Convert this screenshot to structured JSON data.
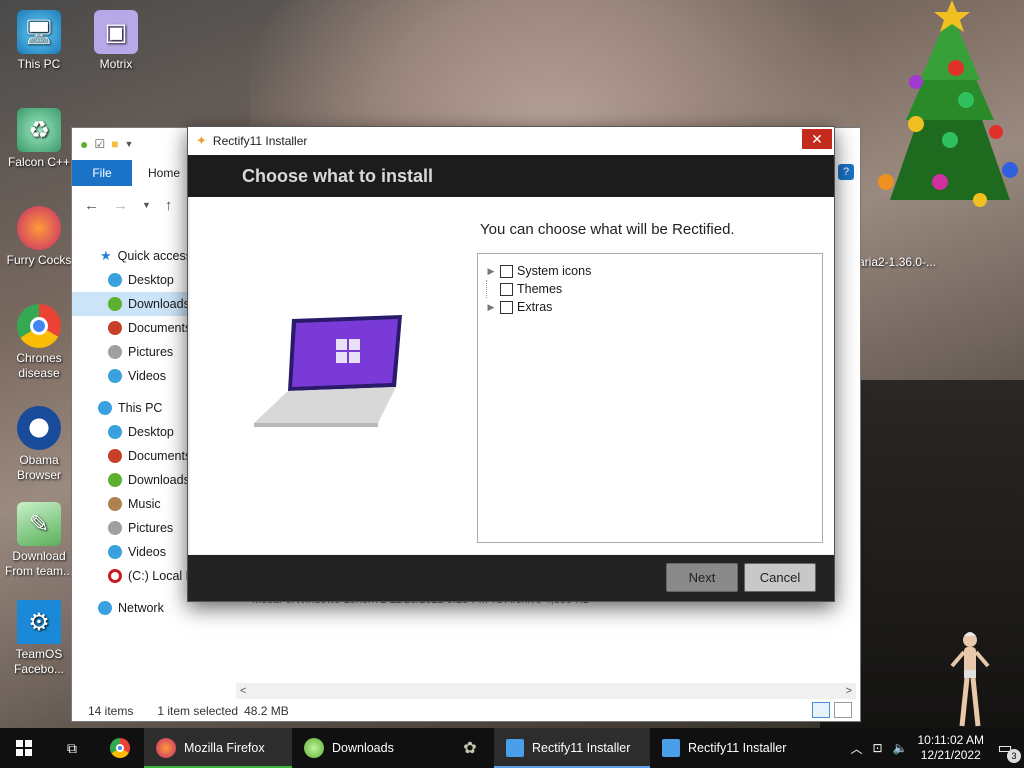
{
  "desktop": {
    "icons": [
      {
        "label": "This PC",
        "icon": "computer-icon"
      },
      {
        "label": "Motrix",
        "icon": "motrix-icon"
      },
      {
        "label": "Falcon C++",
        "icon": "falcon-icon"
      },
      {
        "label": "Furry Cocks",
        "icon": "firefox-icon"
      },
      {
        "label": "Chrones disease",
        "icon": "chrome-icon"
      },
      {
        "label": "Obama Browser",
        "icon": "obama-logo-icon"
      },
      {
        "label": "Download From team...",
        "icon": "notepad-icon"
      },
      {
        "label": "TeamOS Facebo...",
        "icon": "gear-icon"
      }
    ],
    "aria_label": "aria2-1.36.0-..."
  },
  "explorer": {
    "ribbon": {
      "file": "File",
      "home": "Home"
    },
    "tree": [
      {
        "label": "Quick access",
        "color": "#2a7fd4",
        "indent": 0
      },
      {
        "label": "Desktop",
        "color": "#3aa0e0",
        "indent": 1
      },
      {
        "label": "Downloads",
        "color": "#5cb030",
        "indent": 1,
        "selected": true
      },
      {
        "label": "Documents",
        "color": "#c8402c",
        "indent": 1
      },
      {
        "label": "Pictures",
        "color": "#a0a0a0",
        "indent": 1
      },
      {
        "label": "Videos",
        "color": "#3aa0e0",
        "indent": 1
      },
      {
        "label": "This PC",
        "color": "#3aa0e0",
        "indent": 0
      },
      {
        "label": "Desktop",
        "color": "#3aa0e0",
        "indent": 1
      },
      {
        "label": "Documents",
        "color": "#c8402c",
        "indent": 1
      },
      {
        "label": "Downloads",
        "color": "#5cb030",
        "indent": 1
      },
      {
        "label": "Music",
        "color": "#b08050",
        "indent": 1
      },
      {
        "label": "Pictures",
        "color": "#a0a0a0",
        "indent": 1
      },
      {
        "label": "Videos",
        "color": "#3aa0e0",
        "indent": 1
      },
      {
        "label": "(C:) Local D",
        "color": "#c81c1c",
        "indent": 1
      },
      {
        "label": "Network",
        "color": "#3aa0e0",
        "indent": 0
      }
    ],
    "partial_file_row": "MesaForWindows-Lorion72    11/25/2022 5:28 PM    7z Archive    4,859 KB",
    "right_col": [
      "B",
      "B",
      "B",
      "B",
      "B",
      "B",
      "B",
      "B",
      "B",
      "B",
      "B",
      "B",
      "B",
      "B",
      "B",
      "B"
    ],
    "status": {
      "items": "14 items",
      "selected": "1 item selected",
      "size": "48.2 MB"
    }
  },
  "installer": {
    "title": "Rectify11 Installer",
    "heading": "Choose what to install",
    "subtitle": "You can choose what will be Rectified.",
    "options": [
      {
        "label": "System icons",
        "expandable": true
      },
      {
        "label": "Themes",
        "expandable": false
      },
      {
        "label": "Extras",
        "expandable": true
      }
    ],
    "buttons": {
      "next": "Next",
      "cancel": "Cancel"
    }
  },
  "taskbar": {
    "apps": [
      {
        "label": "Mozilla Firefox",
        "icon": "firefox-icon",
        "active": true
      },
      {
        "label": "Downloads",
        "icon": "explorer-icon",
        "active": false
      },
      {
        "label": "Rectify11 Installer",
        "icon": "rectify-icon",
        "active": true
      },
      {
        "label": "Rectify11 Installer",
        "icon": "rectify-icon",
        "active": false
      }
    ],
    "time": "10:11:02 AM",
    "date": "12/21/2022",
    "notifications": "3"
  },
  "colors": {
    "accent": "#1a73c7",
    "close_red": "#c42b1c",
    "selected_bg": "#cce4f7"
  }
}
